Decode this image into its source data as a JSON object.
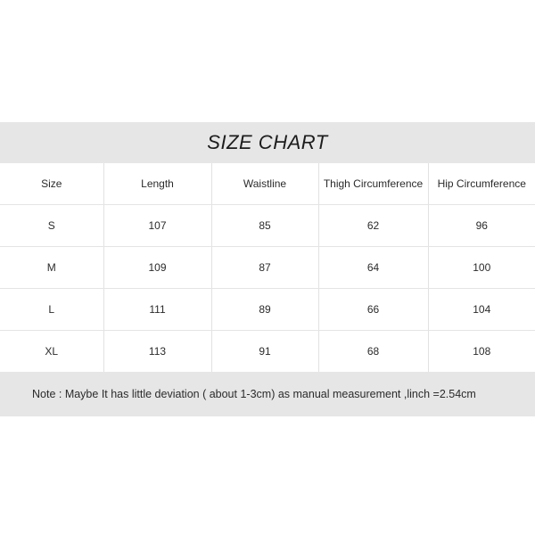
{
  "title": "SIZE CHART",
  "table": {
    "headers": [
      "Size",
      "Length",
      "Waistline",
      "Thigh Circumference",
      "Hip Circumference"
    ],
    "rows": [
      {
        "size": "S",
        "length": "107",
        "waistline": "85",
        "thigh": "62",
        "hip": "96"
      },
      {
        "size": "M",
        "length": "109",
        "waistline": "87",
        "thigh": "64",
        "hip": "100"
      },
      {
        "size": "L",
        "length": "111",
        "waistline": "89",
        "thigh": "66",
        "hip": "104"
      },
      {
        "size": "XL",
        "length": "113",
        "waistline": "91",
        "thigh": "68",
        "hip": "108"
      }
    ]
  },
  "note": "Note : Maybe It has little deviation ( about 1-3cm) as manual measurement ,linch =2.54cm",
  "colors": {
    "band_background": "#e6e6e6",
    "page_background": "#ffffff",
    "text": "#2b2b2b",
    "title_text": "#1c1c1c",
    "grid_line": "#e3e3e3"
  }
}
